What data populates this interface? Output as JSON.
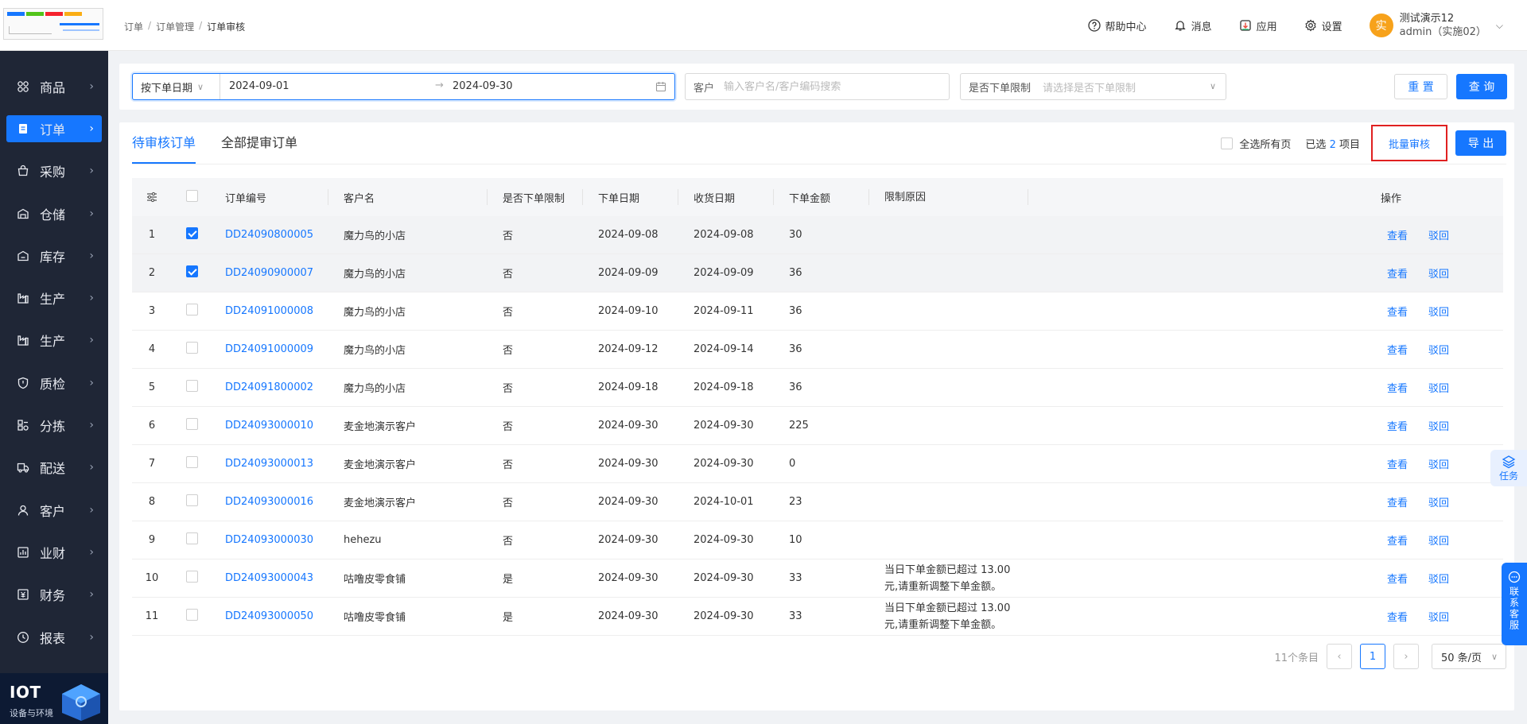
{
  "sidebar": {
    "items": [
      {
        "label": "商品",
        "icon": "grid-icon"
      },
      {
        "label": "订单",
        "icon": "order-icon",
        "active": true
      },
      {
        "label": "采购",
        "icon": "bag-icon"
      },
      {
        "label": "仓储",
        "icon": "warehouse-icon"
      },
      {
        "label": "库存",
        "icon": "inventory-icon"
      },
      {
        "label": "生产",
        "icon": "factory-icon"
      },
      {
        "label": "生产",
        "icon": "factory-icon"
      },
      {
        "label": "质检",
        "icon": "shield-icon"
      },
      {
        "label": "分拣",
        "icon": "sort-icon"
      },
      {
        "label": "配送",
        "icon": "truck-icon"
      },
      {
        "label": "客户",
        "icon": "user-icon"
      },
      {
        "label": "业财",
        "icon": "chart-icon"
      },
      {
        "label": "财务",
        "icon": "finance-icon"
      },
      {
        "label": "报表",
        "icon": "clock-icon"
      }
    ],
    "iot": {
      "title": "IOT",
      "subtitle": "设备与环境"
    }
  },
  "header": {
    "breadcrumbs": [
      "订单",
      "订单管理",
      "订单审核"
    ],
    "help": "帮助中心",
    "messages": "消息",
    "apps": "应用",
    "settings": "设置",
    "user": {
      "avatar_char": "实",
      "name": "测试演示12",
      "account": "admin（实施02）"
    }
  },
  "filter": {
    "date_type": "按下单日期",
    "date_from": "2024-09-01",
    "date_to": "2024-09-30",
    "customer_label": "客户",
    "customer_placeholder": "输入客户名/客户编码搜索",
    "limit_label": "是否下单限制",
    "limit_placeholder": "请选择是否下单限制",
    "reset": "重 置",
    "query": "查 询"
  },
  "tabs": [
    "待审核订单",
    "全部提审订单"
  ],
  "toolbar": {
    "select_all_pages": "全选所有页",
    "selected_prefix": "已选",
    "selected_count": "2",
    "selected_suffix": "项目",
    "batch_approve": "批量审核",
    "export": "导 出"
  },
  "table": {
    "headers": {
      "order_no": "订单编号",
      "customer": "客户名",
      "limit": "是否下单限制",
      "order_date": "下单日期",
      "receive_date": "收货日期",
      "amount": "下单金额",
      "reason": "限制原因",
      "ops": "操作"
    },
    "view_label": "查看",
    "reject_label": "驳回",
    "rows": [
      {
        "idx": "1",
        "checked": true,
        "order_no": "DD24090800005",
        "customer": "魔力鸟的小店",
        "limit": "否",
        "order_date": "2024-09-08",
        "receive_date": "2024-09-08",
        "amount": "30",
        "reason": ""
      },
      {
        "idx": "2",
        "checked": true,
        "order_no": "DD24090900007",
        "customer": "魔力鸟的小店",
        "limit": "否",
        "order_date": "2024-09-09",
        "receive_date": "2024-09-09",
        "amount": "36",
        "reason": ""
      },
      {
        "idx": "3",
        "checked": false,
        "order_no": "DD24091000008",
        "customer": "魔力鸟的小店",
        "limit": "否",
        "order_date": "2024-09-10",
        "receive_date": "2024-09-11",
        "amount": "36",
        "reason": ""
      },
      {
        "idx": "4",
        "checked": false,
        "order_no": "DD24091000009",
        "customer": "魔力鸟的小店",
        "limit": "否",
        "order_date": "2024-09-12",
        "receive_date": "2024-09-14",
        "amount": "36",
        "reason": ""
      },
      {
        "idx": "5",
        "checked": false,
        "order_no": "DD24091800002",
        "customer": "魔力鸟的小店",
        "limit": "否",
        "order_date": "2024-09-18",
        "receive_date": "2024-09-18",
        "amount": "36",
        "reason": ""
      },
      {
        "idx": "6",
        "checked": false,
        "order_no": "DD24093000010",
        "customer": "麦金地演示客户",
        "limit": "否",
        "order_date": "2024-09-30",
        "receive_date": "2024-09-30",
        "amount": "225",
        "reason": ""
      },
      {
        "idx": "7",
        "checked": false,
        "order_no": "DD24093000013",
        "customer": "麦金地演示客户",
        "limit": "否",
        "order_date": "2024-09-30",
        "receive_date": "2024-09-30",
        "amount": "0",
        "reason": ""
      },
      {
        "idx": "8",
        "checked": false,
        "order_no": "DD24093000016",
        "customer": "麦金地演示客户",
        "limit": "否",
        "order_date": "2024-09-30",
        "receive_date": "2024-10-01",
        "amount": "23",
        "reason": ""
      },
      {
        "idx": "9",
        "checked": false,
        "order_no": "DD24093000030",
        "customer": "hehezu",
        "limit": "否",
        "order_date": "2024-09-30",
        "receive_date": "2024-09-30",
        "amount": "10",
        "reason": ""
      },
      {
        "idx": "10",
        "checked": false,
        "order_no": "DD24093000043",
        "customer": "咕噜皮零食铺",
        "limit": "是",
        "order_date": "2024-09-30",
        "receive_date": "2024-09-30",
        "amount": "33",
        "reason": "当日下单金额已超过 13.00 元,请重新调整下单金额。"
      },
      {
        "idx": "11",
        "checked": false,
        "order_no": "DD24093000050",
        "customer": "咕噜皮零食铺",
        "limit": "是",
        "order_date": "2024-09-30",
        "receive_date": "2024-09-30",
        "amount": "33",
        "reason": "当日下单金额已超过 13.00 元,请重新调整下单金额。"
      }
    ]
  },
  "pagination": {
    "total": "11个条目",
    "current": "1",
    "page_size": "50 条/页"
  },
  "floats": {
    "task": "任务",
    "service": "联系客服"
  },
  "colors": {
    "primary": "#1677ff",
    "sidebar": "#1f2636",
    "highlight_border": "#e02020"
  }
}
